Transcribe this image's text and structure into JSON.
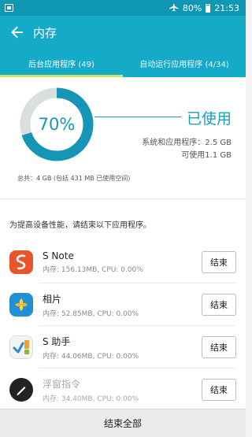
{
  "status_bar": {
    "battery": "80%",
    "time": "21:53"
  },
  "app_bar": {
    "title": "内存"
  },
  "tabs": [
    {
      "label": "后台应用程序 (49)",
      "active": true
    },
    {
      "label": "自动运行应用程序 (4/34)",
      "active": false
    }
  ],
  "summary": {
    "percent_used": 70,
    "percent_label": "70%",
    "used_label": "已使用",
    "system_apps": "系统和应用程序：2.5 GB",
    "available": "可使用1.1 GB",
    "total": "总共：4 GB (包括 431 MB 已使用空间)"
  },
  "apps_section": {
    "title": "为提高设备性能，请结束以下应用程序。",
    "end_label": "结束",
    "apps": [
      {
        "name": "S Note",
        "usage": "内存: 156.13MB, CPU: 0.00%",
        "icon": "s-note-icon",
        "dimmed": false
      },
      {
        "name": "相片",
        "usage": "内存: 52.85MB, CPU: 0.00%",
        "icon": "gallery-icon",
        "dimmed": false
      },
      {
        "name": "S 助手",
        "usage": "内存: 44.06MB, CPU: 0.00%",
        "icon": "s-assistant-icon",
        "dimmed": false
      },
      {
        "name": "浮窗指令",
        "usage": "内存: 34.40MB, CPU: 0.00%",
        "icon": "air-command-icon",
        "dimmed": true
      }
    ]
  },
  "footer": {
    "end_all_label": "结束全部"
  },
  "colors": {
    "header": "#15aac7",
    "status_bar": "#0f97b3",
    "gauge_used": "#1596b6",
    "gauge_free": "#d9dedf",
    "tab_indicator": "#c8e86a"
  }
}
